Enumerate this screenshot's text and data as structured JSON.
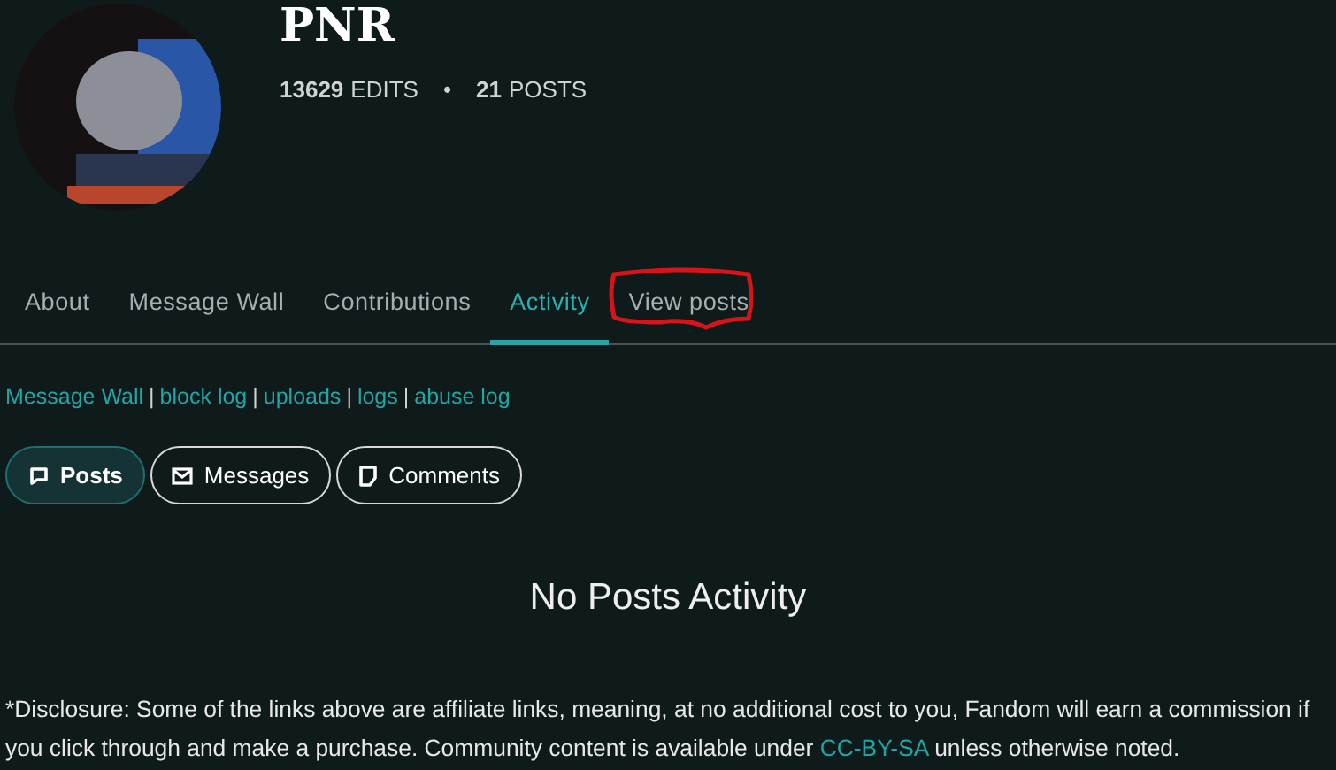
{
  "profile": {
    "username": "PNR",
    "stats": [
      {
        "value": "13629",
        "label": "EDITS"
      },
      {
        "value": "21",
        "label": "POSTS"
      }
    ],
    "separator": "•"
  },
  "tabs": [
    {
      "label": "About",
      "selected": false,
      "annotated": false
    },
    {
      "label": "Message Wall",
      "selected": false,
      "annotated": false
    },
    {
      "label": "Contributions",
      "selected": false,
      "annotated": false
    },
    {
      "label": "Activity",
      "selected": true,
      "annotated": false
    },
    {
      "label": "View posts",
      "selected": false,
      "annotated": true
    }
  ],
  "tool_links": [
    "Message Wall",
    "block log",
    "uploads",
    "logs",
    "abuse log"
  ],
  "link_separator": "|",
  "filters": [
    {
      "label": "Posts",
      "selected": true
    },
    {
      "label": "Messages",
      "selected": false
    },
    {
      "label": "Comments",
      "selected": false
    }
  ],
  "empty_message": "No Posts Activity",
  "disclosure": {
    "before": "*Disclosure: Some of the links above are affiliate links, meaning, at no additional cost to you, Fandom will earn a commission if you click through and make a purchase. Community content is available under ",
    "link": "CC-BY-SA",
    "after": " unless otherwise noted."
  }
}
